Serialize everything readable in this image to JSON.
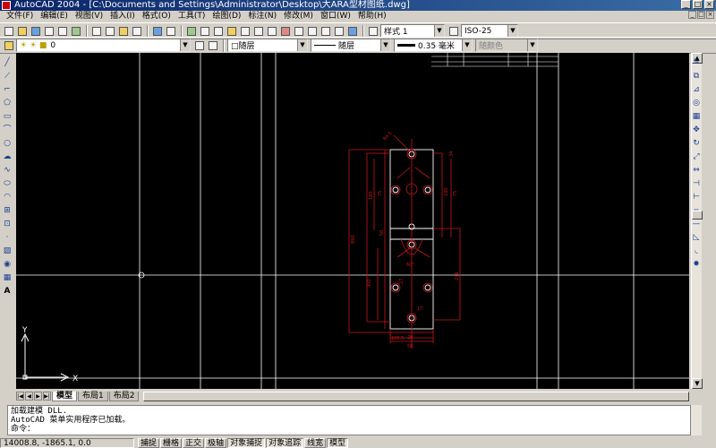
{
  "window": {
    "title": "AutoCAD 2004 - [C:\\Documents and Settings\\Administrator\\Desktop\\大ARA型材图纸.dwg]",
    "controls": [
      "_",
      "□",
      "×"
    ]
  },
  "menu": {
    "items": [
      "文件(F)",
      "编辑(E)",
      "视图(V)",
      "插入(I)",
      "格式(O)",
      "工具(T)",
      "绘图(D)",
      "标注(N)",
      "修改(M)",
      "窗口(W)",
      "帮助(H)"
    ]
  },
  "styles_toolbar": {
    "text_style": "样式 1",
    "dim_style": "ISO-25"
  },
  "layers_toolbar": {
    "layer": "0",
    "color": "□随层",
    "linetype": "随层",
    "lineweight": "0.35 毫米",
    "plotstyle": "随颜色"
  },
  "layout_tabs": [
    {
      "label": "模型",
      "active": true
    },
    {
      "label": "布局1",
      "active": false
    },
    {
      "label": "布局2",
      "active": false
    }
  ],
  "ucs": {
    "x_label": "X",
    "y_label": "Y"
  },
  "command_lines": [
    "加载建模 DLL.",
    "AutoCAD 菜单实用程序已加载。",
    "命令："
  ],
  "status": {
    "coords": "14008.8, -1865.1, 0.0",
    "buttons": [
      {
        "label": "捕捉",
        "on": false
      },
      {
        "label": "栅格",
        "on": false
      },
      {
        "label": "正交",
        "on": false
      },
      {
        "label": "极轴",
        "on": false
      },
      {
        "label": "对象捕捉",
        "on": true
      },
      {
        "label": "对象追踪",
        "on": true
      },
      {
        "label": "线宽",
        "on": false
      },
      {
        "label": "模型",
        "on": true
      }
    ]
  },
  "drawing": {
    "dims": {
      "overall_height": "890",
      "overall_width": "56",
      "top_width": "34",
      "upper_left": "180",
      "upper_left_2": "75",
      "mid_left": "50",
      "lower_left": "300",
      "lower_left_2": "27",
      "right_1": "180",
      "right_2": "75",
      "right_3": "276",
      "bottom_1": "17",
      "bottom_2": "100.5",
      "bottom_3": "29",
      "angle": "60°",
      "radius": "R4.5"
    },
    "colors": {
      "dim": "#c8161e",
      "geom": "#ffffff",
      "bg": "#000000"
    }
  }
}
